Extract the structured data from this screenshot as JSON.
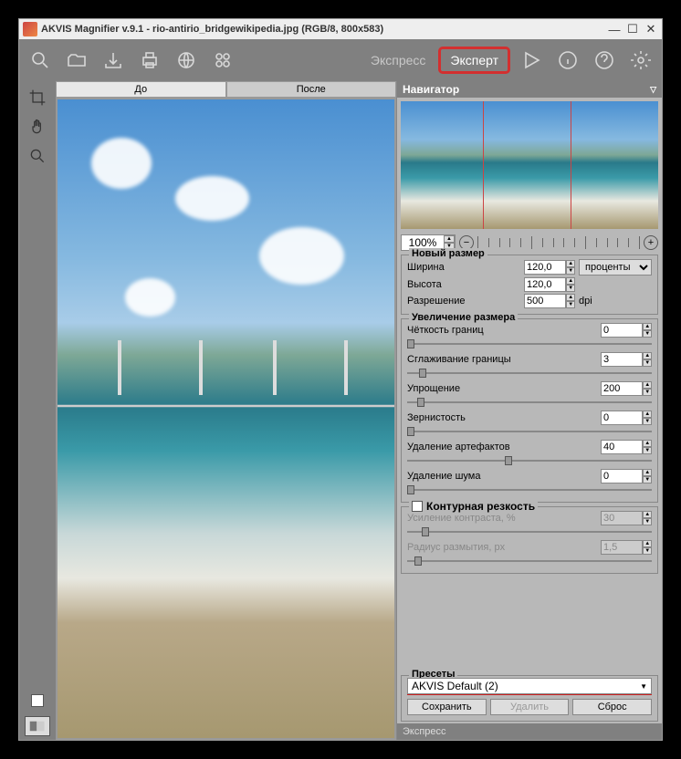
{
  "title": "AKVIS Magnifier v.9.1 - rio-antirio_bridgewikipedia.jpg (RGB/8, 800x583)",
  "modes": {
    "express": "Экспресс",
    "expert": "Эксперт"
  },
  "tabs": {
    "before": "До",
    "after": "После"
  },
  "panels": {
    "navigator": "Навигатор"
  },
  "zoom": {
    "value": "100%"
  },
  "newSize": {
    "label": "Новый размер",
    "widthLabel": "Ширина",
    "width": "120,0",
    "heightLabel": "Высота",
    "height": "120,0",
    "resLabel": "Разрешение",
    "res": "500",
    "units": "проценты",
    "resUnits": "dpi"
  },
  "enlarge": {
    "label": "Увеличение размера",
    "edgeSharp": {
      "label": "Чёткость границ",
      "value": "0"
    },
    "edgeSmooth": {
      "label": "Сглаживание границы",
      "value": "3"
    },
    "simplify": {
      "label": "Упрощение",
      "value": "200"
    },
    "grain": {
      "label": "Зернистость",
      "value": "0"
    },
    "artifact": {
      "label": "Удаление артефактов",
      "value": "40"
    },
    "noise": {
      "label": "Удаление шума",
      "value": "0"
    }
  },
  "unsharp": {
    "label": "Контурная резкость",
    "contrast": {
      "label": "Усиление контраста, %",
      "value": "30"
    },
    "radius": {
      "label": "Радиус размытия, px",
      "value": "1,5"
    }
  },
  "presets": {
    "label": "Пресеты",
    "selected": "AKVIS Default (2)",
    "save": "Сохранить",
    "delete": "Удалить",
    "reset": "Сброс"
  },
  "footer": "Экспресс"
}
